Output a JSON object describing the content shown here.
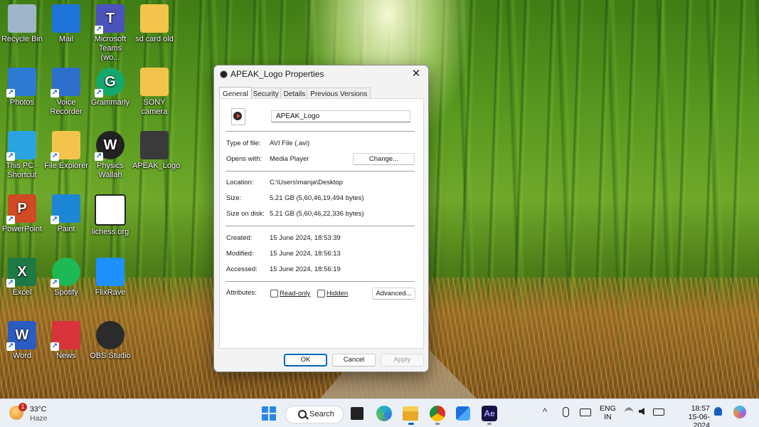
{
  "desktop": {
    "icons": [
      {
        "label": "Recycle Bin",
        "icon": "recycle-bin-icon",
        "color": "#9fb6c9"
      },
      {
        "label": "Mail",
        "icon": "mail-icon",
        "color": "#1e73d8"
      },
      {
        "label": "Microsoft Teams (wo...",
        "icon": "teams-icon",
        "color": "#4b53bc"
      },
      {
        "label": "sd card old",
        "icon": "folder-icon",
        "color": "#f3c44c"
      },
      {
        "label": "Photos",
        "icon": "photos-icon",
        "color": "#2e7bd6"
      },
      {
        "label": "Voice Recorder",
        "icon": "voice-recorder-icon",
        "color": "#2f6fcc"
      },
      {
        "label": "Grammarly",
        "icon": "grammarly-icon",
        "color": "#15a86c"
      },
      {
        "label": "SONY camera",
        "icon": "folder-icon",
        "color": "#f3c44c"
      },
      {
        "label": "This PC - Shortcut",
        "icon": "monitor-icon",
        "color": "#2aa3e0"
      },
      {
        "label": "File Explorer",
        "icon": "folder-icon",
        "color": "#f3c44c"
      },
      {
        "label": "Physics Wallah",
        "icon": "physics-wallah-icon",
        "color": "#222222"
      },
      {
        "label": "APEAK_Logo",
        "icon": "video-file-icon",
        "color": "#3a3a3a"
      },
      {
        "label": "PowerPoint",
        "icon": "powerpoint-icon",
        "color": "#d04a24"
      },
      {
        "label": "Paint",
        "icon": "paint-icon",
        "color": "#1e86d6"
      },
      {
        "label": "lichess.org",
        "icon": "lichess-icon",
        "color": "#ffffff"
      },
      {
        "label": "Excel",
        "icon": "excel-icon",
        "color": "#1d7a45"
      },
      {
        "label": "Spotify",
        "icon": "spotify-icon",
        "color": "#1db954"
      },
      {
        "label": "FlixRave",
        "icon": "flixrave-icon",
        "color": "#1e90ff"
      },
      {
        "label": "Word",
        "icon": "word-icon",
        "color": "#2b5cc2"
      },
      {
        "label": "News",
        "icon": "news-icon",
        "color": "#d8333a"
      },
      {
        "label": "OBS Studio",
        "icon": "obs-studio-icon",
        "color": "#2b2b2b"
      }
    ],
    "glyphs": {
      "pp": "P",
      "xl": "X",
      "wd": "W",
      "gm": "G",
      "pw": "W",
      "teams": "T"
    }
  },
  "dialog": {
    "title": "APEAK_Logo Properties",
    "close": "✕",
    "tabs": [
      "General",
      "Security",
      "Details",
      "Previous Versions"
    ],
    "file_name": "APEAK_Logo",
    "type_label": "Type of file:",
    "type_value": "AVI File (.avi)",
    "opens_label": "Opens with:",
    "opens_value": "Media Player",
    "change_button": "Change...",
    "location_label": "Location:",
    "location_value": "C:\\Users\\manja\\Desktop",
    "size_label": "Size:",
    "size_value": "5.21 GB (5,60,46,19,494 bytes)",
    "size_disk_label": "Size on disk:",
    "size_disk_value": "5.21 GB (5,60,46,22,336 bytes)",
    "created_label": "Created:",
    "created_value": "15 June 2024, 18:53:39",
    "modified_label": "Modified:",
    "modified_value": "15 June 2024, 18:56:13",
    "accessed_label": "Accessed:",
    "accessed_value": "15 June 2024, 18:56:19",
    "attributes_label": "Attributes:",
    "readonly_label": "Read-only",
    "hidden_label": "Hidden",
    "advanced_button": "Advanced...",
    "ok_button": "OK",
    "cancel_button": "Cancel",
    "apply_button": "Apply"
  },
  "taskbar": {
    "weather_temp": "33°C",
    "weather_desc": "Haze",
    "weather_badge": "1",
    "search_label": "Search",
    "lang_top": "ENG",
    "lang_bottom": "IN",
    "time": "18:57",
    "date": "15-06-2024",
    "chevron": "^",
    "ae_label": "Ae"
  }
}
